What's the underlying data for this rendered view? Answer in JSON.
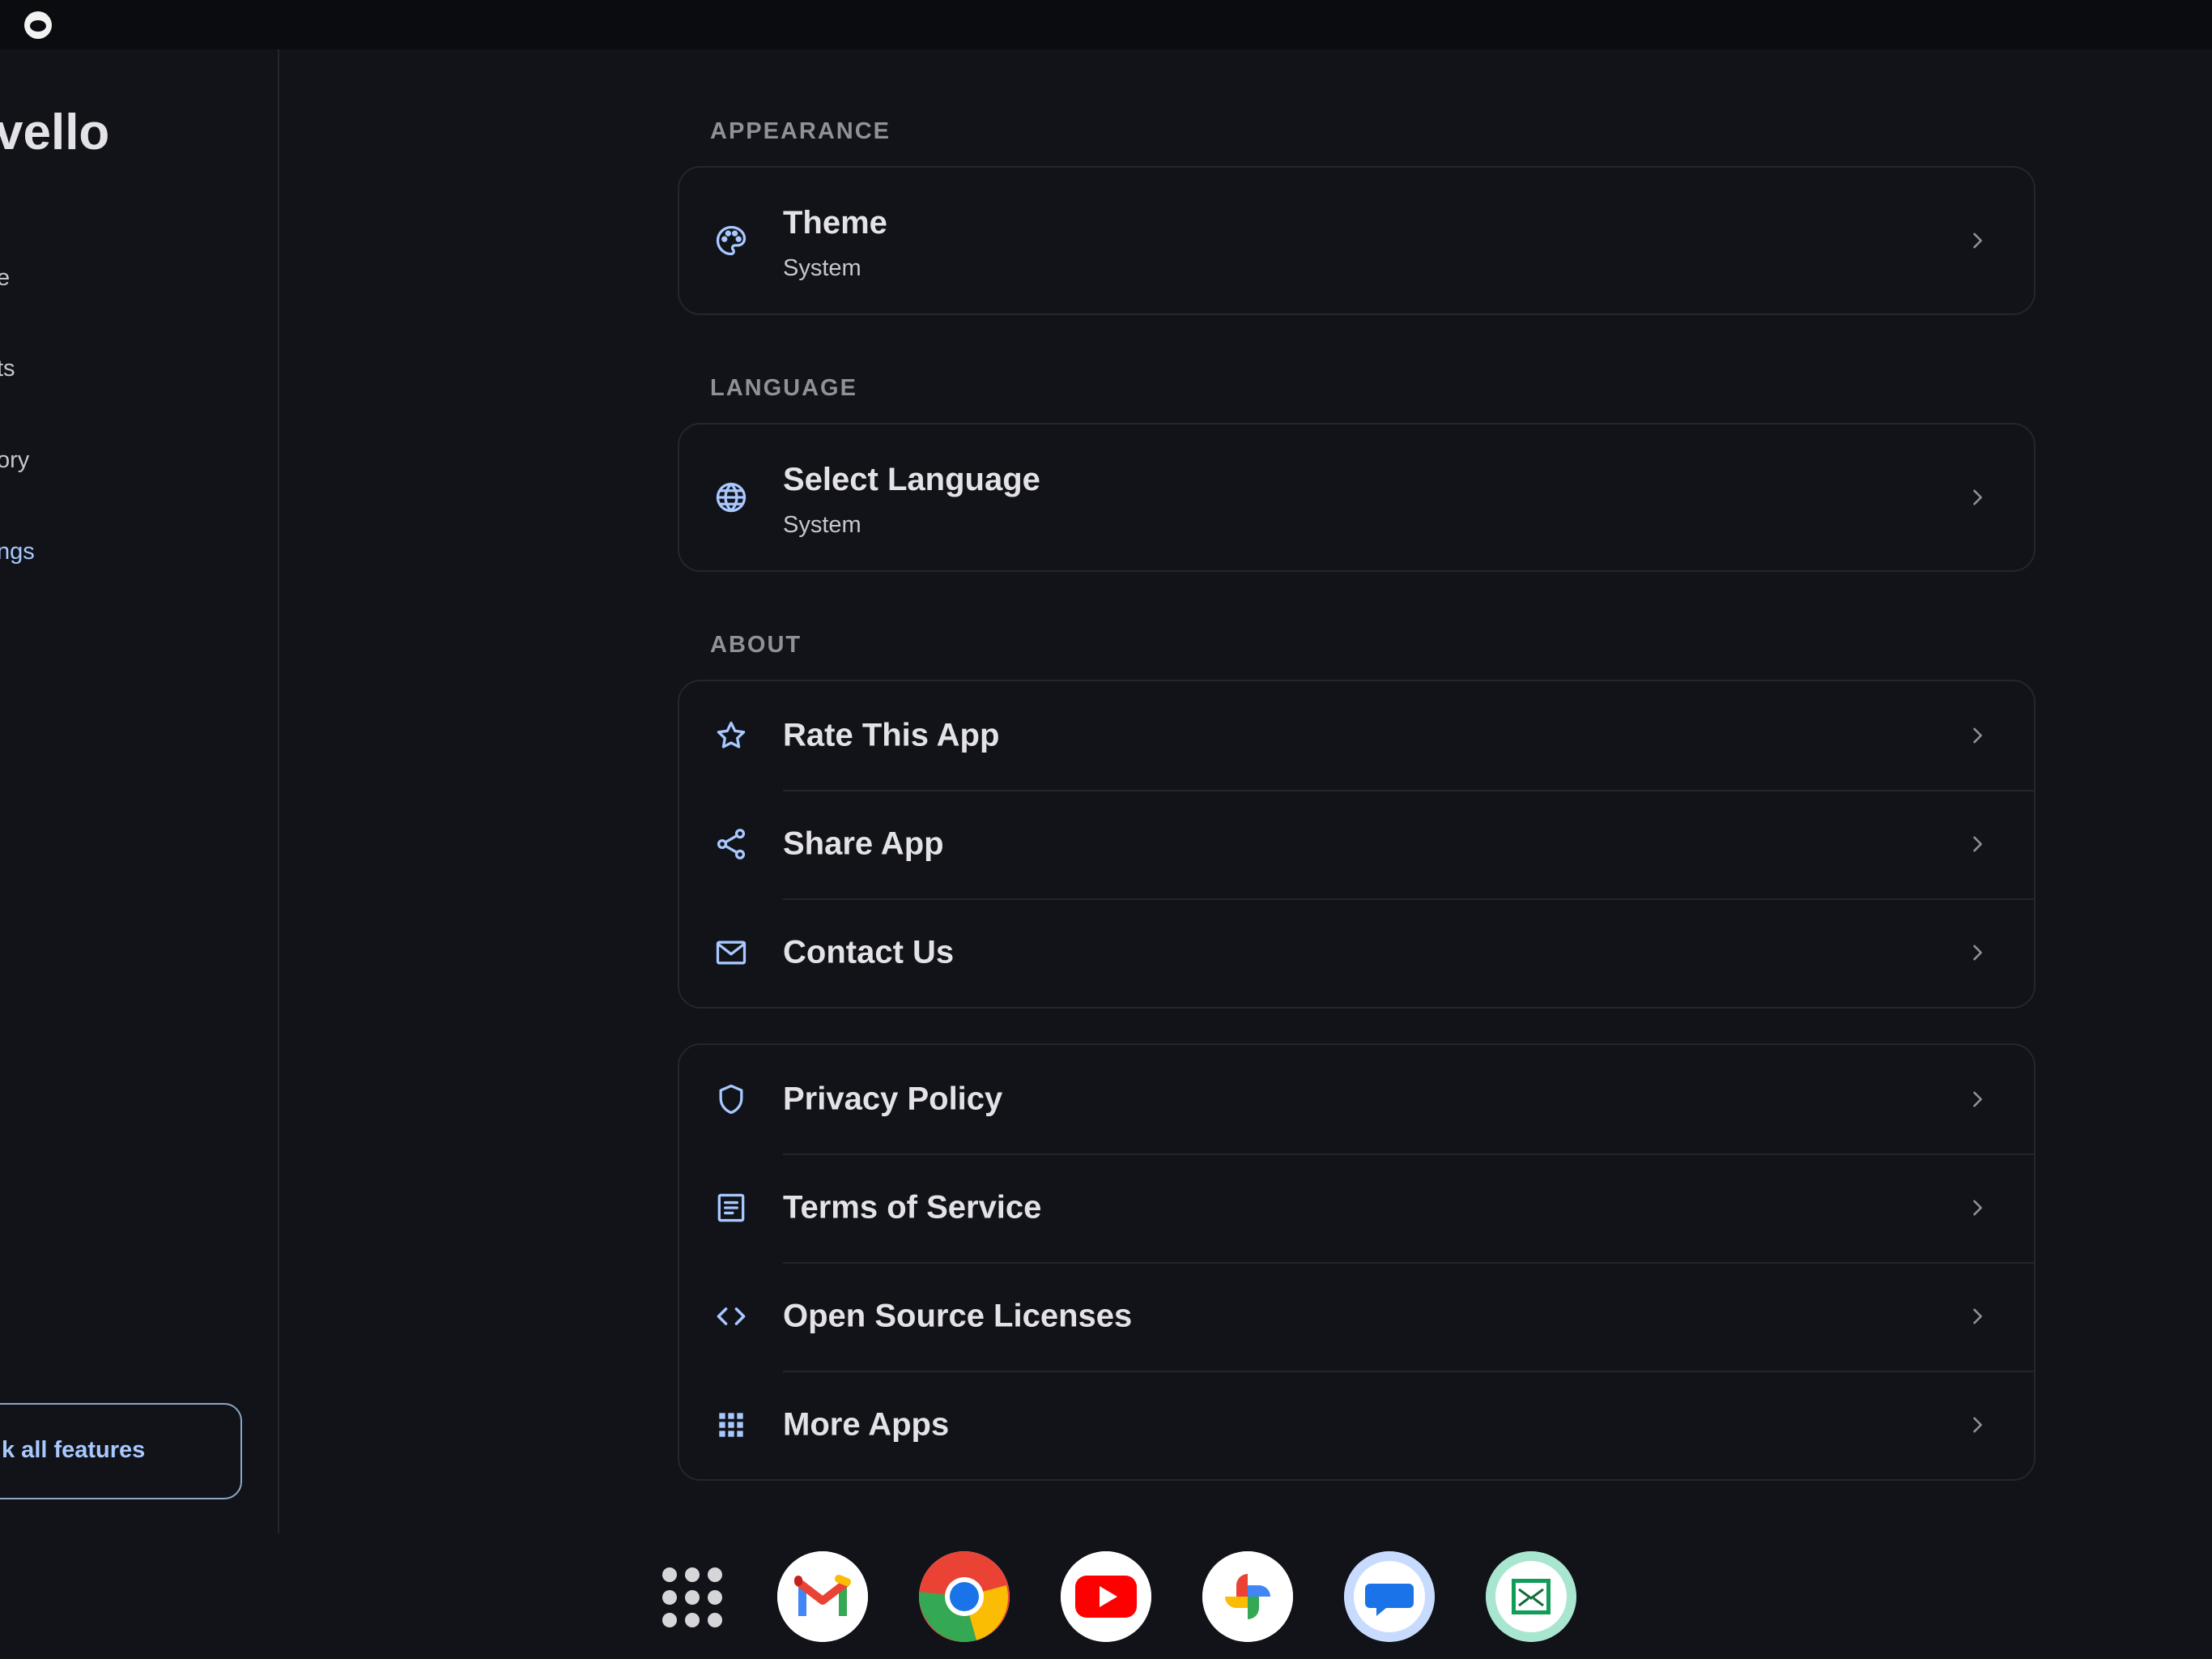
{
  "app": {
    "title": "vello"
  },
  "sidebar": {
    "items": [
      {
        "label": "e"
      },
      {
        "label": "ts"
      },
      {
        "label": "ory"
      },
      {
        "label": "ngs"
      }
    ],
    "unlock_label": "k all features"
  },
  "sections": {
    "appearance": {
      "title": "APPEARANCE",
      "theme": {
        "label": "Theme",
        "value": "System",
        "icon": "palette-icon"
      }
    },
    "language": {
      "title": "LANGUAGE",
      "select": {
        "label": "Select Language",
        "value": "System",
        "icon": "globe-icon"
      }
    },
    "about": {
      "title": "ABOUT",
      "items": [
        {
          "label": "Rate This App",
          "icon": "star-icon"
        },
        {
          "label": "Share App",
          "icon": "share-icon"
        },
        {
          "label": "Contact Us",
          "icon": "mail-icon"
        }
      ]
    },
    "legal": {
      "items": [
        {
          "label": "Privacy Policy",
          "icon": "shield-icon"
        },
        {
          "label": "Terms of Service",
          "icon": "document-icon"
        },
        {
          "label": "Open Source Licenses",
          "icon": "code-icon"
        },
        {
          "label": "More Apps",
          "icon": "grid-icon"
        }
      ]
    }
  },
  "dock": {
    "apps": [
      "launcher-icon",
      "gmail-icon",
      "chrome-icon",
      "youtube-icon",
      "photos-icon",
      "messages-icon",
      "classroom-icon"
    ]
  },
  "colors": {
    "background": "#111318",
    "accent": "#a8c8ff",
    "text": "#e3e2e6",
    "muted": "#8f9099",
    "border": "#23262d"
  }
}
